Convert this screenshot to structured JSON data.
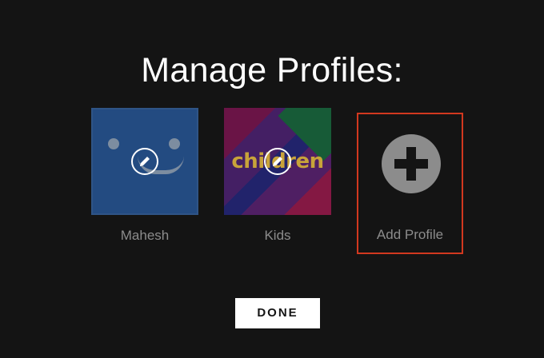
{
  "page": {
    "title": "Manage Profiles:"
  },
  "profiles": [
    {
      "name": "Mahesh",
      "avatar": "smiley-blue-avatar",
      "edit_icon": "pencil-icon"
    },
    {
      "name": "Kids",
      "avatar": "children-avatar",
      "avatar_text": "children",
      "edit_icon": "pencil-icon"
    }
  ],
  "add_profile": {
    "label": "Add Profile",
    "icon": "plus-icon"
  },
  "done_button": {
    "label": "DONE"
  },
  "colors": {
    "background": "#141414",
    "text_primary": "#ffffff",
    "text_secondary": "#8c8c8c",
    "highlight_border": "#d2381f",
    "button_bg": "#ffffff"
  }
}
